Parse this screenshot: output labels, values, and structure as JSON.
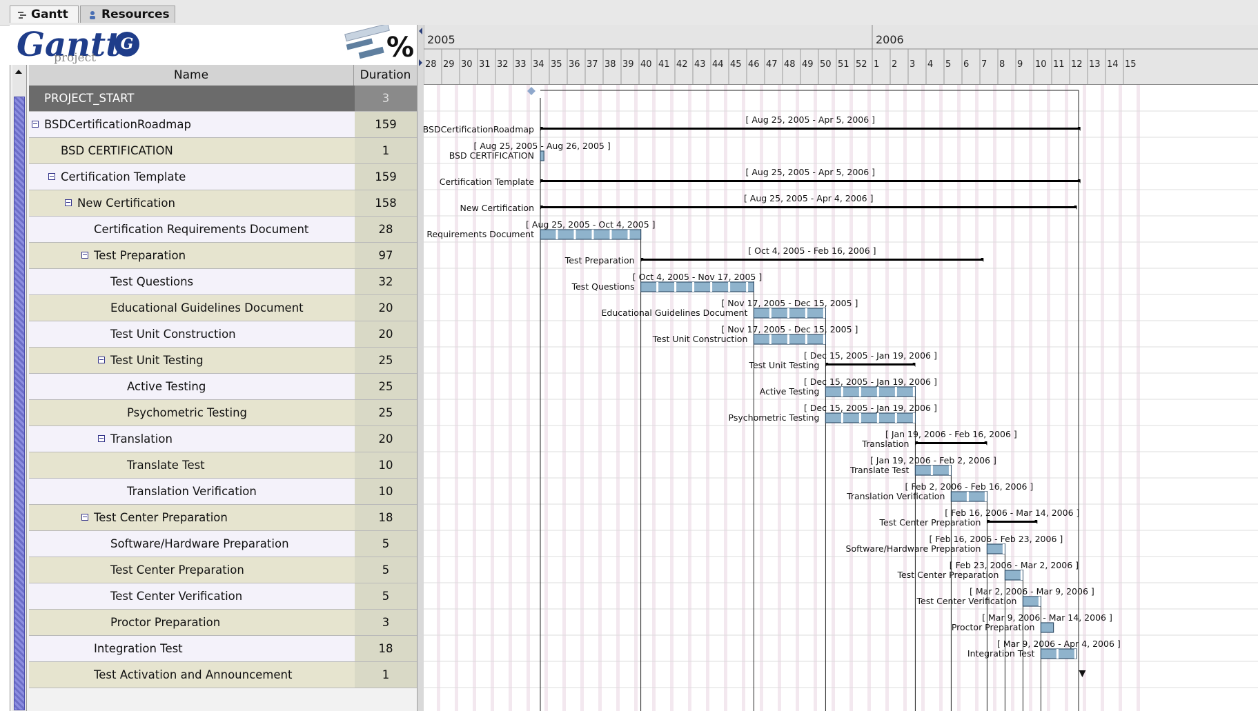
{
  "tabs": [
    {
      "label": "Gantt",
      "active": true
    },
    {
      "label": "Resources",
      "active": false
    }
  ],
  "logo": {
    "text": "Gantt",
    "subtext": "project",
    "percent": "%"
  },
  "table": {
    "headers": {
      "name": "Name",
      "duration": "Duration"
    },
    "rows": [
      {
        "name": "PROJECT_START",
        "duration": "3",
        "level": 0,
        "expander": false,
        "selected": true
      },
      {
        "name": "BSDCertificationRoadmap",
        "duration": "159",
        "level": 0,
        "expander": true
      },
      {
        "name": "BSD CERTIFICATION",
        "duration": "1",
        "level": 1,
        "expander": false
      },
      {
        "name": "Certification Template",
        "duration": "159",
        "level": 1,
        "expander": true
      },
      {
        "name": "New Certification",
        "duration": "158",
        "level": 2,
        "expander": true
      },
      {
        "name": "Certification Requirements Document",
        "duration": "28",
        "level": 3,
        "expander": false
      },
      {
        "name": "Test Preparation",
        "duration": "97",
        "level": 3,
        "expander": true
      },
      {
        "name": "Test Questions",
        "duration": "32",
        "level": 4,
        "expander": false
      },
      {
        "name": "Educational Guidelines Document",
        "duration": "20",
        "level": 4,
        "expander": false
      },
      {
        "name": "Test Unit Construction",
        "duration": "20",
        "level": 4,
        "expander": false
      },
      {
        "name": "Test Unit Testing",
        "duration": "25",
        "level": 4,
        "expander": true
      },
      {
        "name": "Active Testing",
        "duration": "25",
        "level": 5,
        "expander": false
      },
      {
        "name": "Psychometric Testing",
        "duration": "25",
        "level": 5,
        "expander": false
      },
      {
        "name": "Translation",
        "duration": "20",
        "level": 4,
        "expander": true
      },
      {
        "name": "Translate Test",
        "duration": "10",
        "level": 5,
        "expander": false
      },
      {
        "name": "Translation Verification",
        "duration": "10",
        "level": 5,
        "expander": false
      },
      {
        "name": "Test Center Preparation",
        "duration": "18",
        "level": 3,
        "expander": true
      },
      {
        "name": "Software/Hardware Preparation",
        "duration": "5",
        "level": 4,
        "expander": false
      },
      {
        "name": "Test Center Preparation",
        "duration": "5",
        "level": 4,
        "expander": false
      },
      {
        "name": "Test Center Verification",
        "duration": "5",
        "level": 4,
        "expander": false
      },
      {
        "name": "Proctor Preparation",
        "duration": "3",
        "level": 4,
        "expander": false
      },
      {
        "name": "Integration Test",
        "duration": "18",
        "level": 3,
        "expander": false
      },
      {
        "name": "Test Activation and Announcement",
        "duration": "1",
        "level": 3,
        "expander": false
      }
    ]
  },
  "timeline": {
    "years": [
      {
        "label": "2005",
        "week": 28
      },
      {
        "label": "2006",
        "week": 53
      }
    ],
    "weeks": [
      "28",
      "29",
      "30",
      "31",
      "32",
      "33",
      "34",
      "35",
      "36",
      "37",
      "38",
      "39",
      "40",
      "41",
      "42",
      "43",
      "44",
      "45",
      "46",
      "47",
      "48",
      "49",
      "50",
      "51",
      "52",
      "1",
      "2",
      "3",
      "4",
      "5",
      "6",
      "7",
      "8",
      "9",
      "10",
      "11",
      "12",
      "13",
      "14",
      "15"
    ],
    "tasks": [
      {
        "row": 0,
        "kind": "milestone",
        "start": 34.0
      },
      {
        "row": 1,
        "kind": "summary",
        "start": 34.5,
        "end": 64.6,
        "name": "BSDCertificationRoadmap",
        "range": "[ Aug 25, 2005 - Apr 5, 2006 ]"
      },
      {
        "row": 2,
        "kind": "task",
        "start": 34.5,
        "end": 34.7,
        "name": "BSD CERTIFICATION",
        "range": "[ Aug 25, 2005 - Aug 26, 2005 ]"
      },
      {
        "row": 3,
        "kind": "summary",
        "start": 34.5,
        "end": 64.6,
        "name": "Certification Template",
        "range": "[ Aug 25, 2005 - Apr 5, 2006 ]"
      },
      {
        "row": 4,
        "kind": "summary",
        "start": 34.5,
        "end": 64.4,
        "name": "New Certification",
        "range": "[ Aug 25, 2005 - Apr 4, 2006 ]"
      },
      {
        "row": 5,
        "kind": "task",
        "start": 34.5,
        "end": 40.1,
        "name": "Certification Requirements Document",
        "range": "[ Aug 25, 2005 - Oct 4, 2005 ]"
      },
      {
        "row": 6,
        "kind": "summary",
        "start": 40.1,
        "end": 59.2,
        "name": "Test Preparation",
        "range": "[ Oct 4, 2005 - Feb 16, 2006 ]"
      },
      {
        "row": 7,
        "kind": "task",
        "start": 40.1,
        "end": 46.4,
        "name": "Test Questions",
        "range": "[ Oct 4, 2005 - Nov 17, 2005 ]"
      },
      {
        "row": 8,
        "kind": "task",
        "start": 46.4,
        "end": 50.4,
        "name": "Educational Guidelines Document",
        "range": "[ Nov 17, 2005 - Dec 15, 2005 ]"
      },
      {
        "row": 9,
        "kind": "task",
        "start": 46.4,
        "end": 50.4,
        "name": "Test Unit Construction",
        "range": "[ Nov 17, 2005 - Dec 15, 2005 ]"
      },
      {
        "row": 10,
        "kind": "summary",
        "start": 50.4,
        "end": 55.4,
        "name": "Test Unit Testing",
        "range": "[ Dec 15, 2005 - Jan 19, 2006 ]"
      },
      {
        "row": 11,
        "kind": "task",
        "start": 50.4,
        "end": 55.4,
        "name": "Active Testing",
        "range": "[ Dec 15, 2005 - Jan 19, 2006 ]"
      },
      {
        "row": 12,
        "kind": "task",
        "start": 50.4,
        "end": 55.4,
        "name": "Psychometric Testing",
        "range": "[ Dec 15, 2005 - Jan 19, 2006 ]"
      },
      {
        "row": 13,
        "kind": "summary",
        "start": 55.4,
        "end": 59.4,
        "name": "Translation",
        "range": "[ Jan 19, 2006 - Feb 16, 2006 ]"
      },
      {
        "row": 14,
        "kind": "task",
        "start": 55.4,
        "end": 57.4,
        "name": "Translate Test",
        "range": "[ Jan 19, 2006 - Feb 2, 2006 ]"
      },
      {
        "row": 15,
        "kind": "task",
        "start": 57.4,
        "end": 59.4,
        "name": "Translation Verification",
        "range": "[ Feb 2, 2006 - Feb 16, 2006 ]"
      },
      {
        "row": 16,
        "kind": "summary",
        "start": 59.4,
        "end": 62.2,
        "name": "Test Center Preparation",
        "range": "[ Feb 16, 2006 - Mar 14, 2006 ]"
      },
      {
        "row": 17,
        "kind": "task",
        "start": 59.4,
        "end": 60.4,
        "name": "Software/Hardware Preparation",
        "range": "[ Feb 16, 2006 - Feb 23, 2006 ]"
      },
      {
        "row": 18,
        "kind": "task",
        "start": 60.4,
        "end": 61.4,
        "name": "Test Center Preparation",
        "range": "[ Feb 23, 2006 - Mar 2, 2006 ]"
      },
      {
        "row": 19,
        "kind": "task",
        "start": 61.4,
        "end": 62.4,
        "name": "Test Center Verification",
        "range": "[ Mar 2, 2006 - Mar 9, 2006 ]"
      },
      {
        "row": 20,
        "kind": "task",
        "start": 62.4,
        "end": 63.1,
        "name": "Proctor Preparation",
        "range": "[ Mar 9, 2006 - Mar 14, 2006 ]"
      },
      {
        "row": 21,
        "kind": "task",
        "start": 62.4,
        "end": 64.4,
        "name": "Integration Test",
        "range": "[ Mar 9, 2006 - Apr 4, 2006 ]"
      },
      {
        "row": 22,
        "kind": "milestone-end",
        "start": 64.4
      }
    ]
  },
  "colors": {
    "bar": "#8fb3cc",
    "barBorder": "#33506a",
    "summary": "#000000",
    "selectedRow": "#6b6b6b",
    "oddRow": "#f4f2fa",
    "evenRow": "#e6e4cf",
    "durCell": "#d9d9c6",
    "gridStripe": "#f3e8ef",
    "milestone": "#8fa8cc"
  }
}
